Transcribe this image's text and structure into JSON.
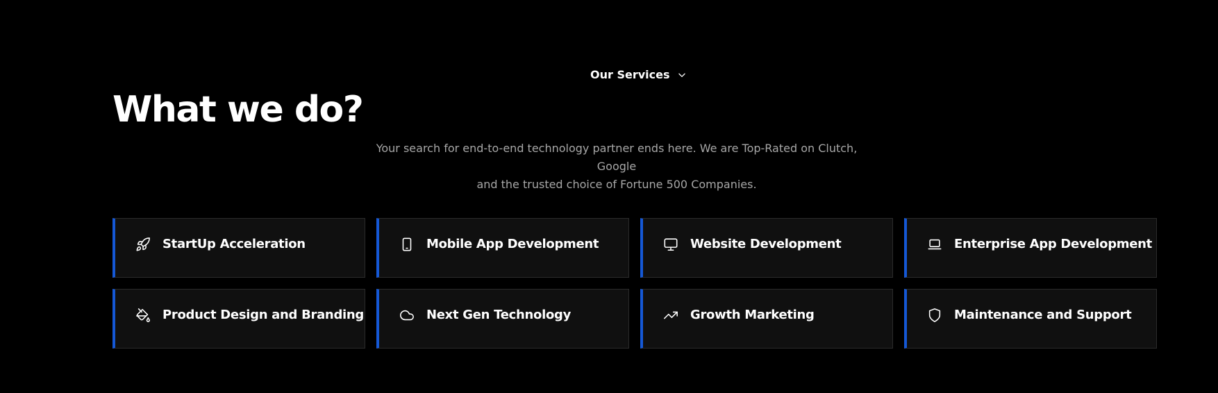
{
  "header": {
    "section_label": "Our Services",
    "title": "What we do?",
    "subtitle_line1": "Your search for end-to-end technology partner ends here. We are Top-Rated on Clutch, Google",
    "subtitle_line2": "and the trusted choice of Fortune 500 Companies."
  },
  "accent_color": "#1558d6",
  "services": [
    {
      "label": "StartUp Acceleration",
      "icon": "rocket-icon"
    },
    {
      "label": "Mobile App Development",
      "icon": "smartphone-icon"
    },
    {
      "label": "Website Development",
      "icon": "monitor-icon"
    },
    {
      "label": "Enterprise App Development",
      "icon": "laptop-icon"
    },
    {
      "label": "Product Design and Branding",
      "icon": "paint-bucket-icon"
    },
    {
      "label": "Next Gen Technology",
      "icon": "cloud-icon"
    },
    {
      "label": "Growth Marketing",
      "icon": "trending-up-icon"
    },
    {
      "label": "Maintenance and Support",
      "icon": "shield-icon"
    }
  ]
}
